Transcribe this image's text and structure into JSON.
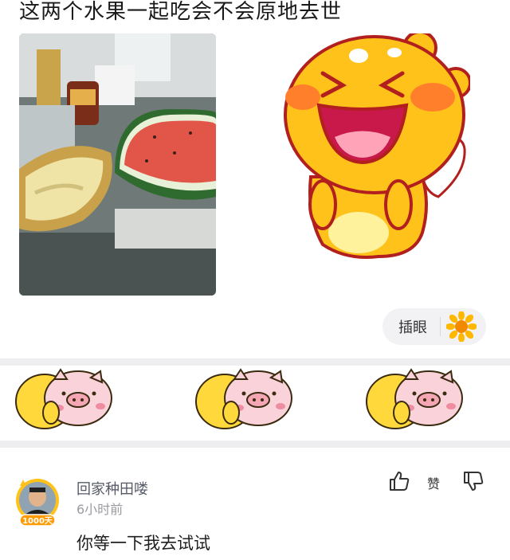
{
  "post": {
    "text": "这两个水果一起吃会不会原地去世"
  },
  "tag_button": {
    "label": "插眼",
    "icon": "sunflower-icon"
  },
  "comment": {
    "username": "回家种田喽",
    "time": "6小时前",
    "text": "你等一下我去试试",
    "like_label": "赞",
    "avatar_badge": "1000天"
  },
  "colors": {
    "sticker_yellow": "#ffc21a",
    "band_gray": "#eeeef0",
    "pill_bg": "#f2f2f4",
    "pig_pink": "#f9d3d9"
  }
}
